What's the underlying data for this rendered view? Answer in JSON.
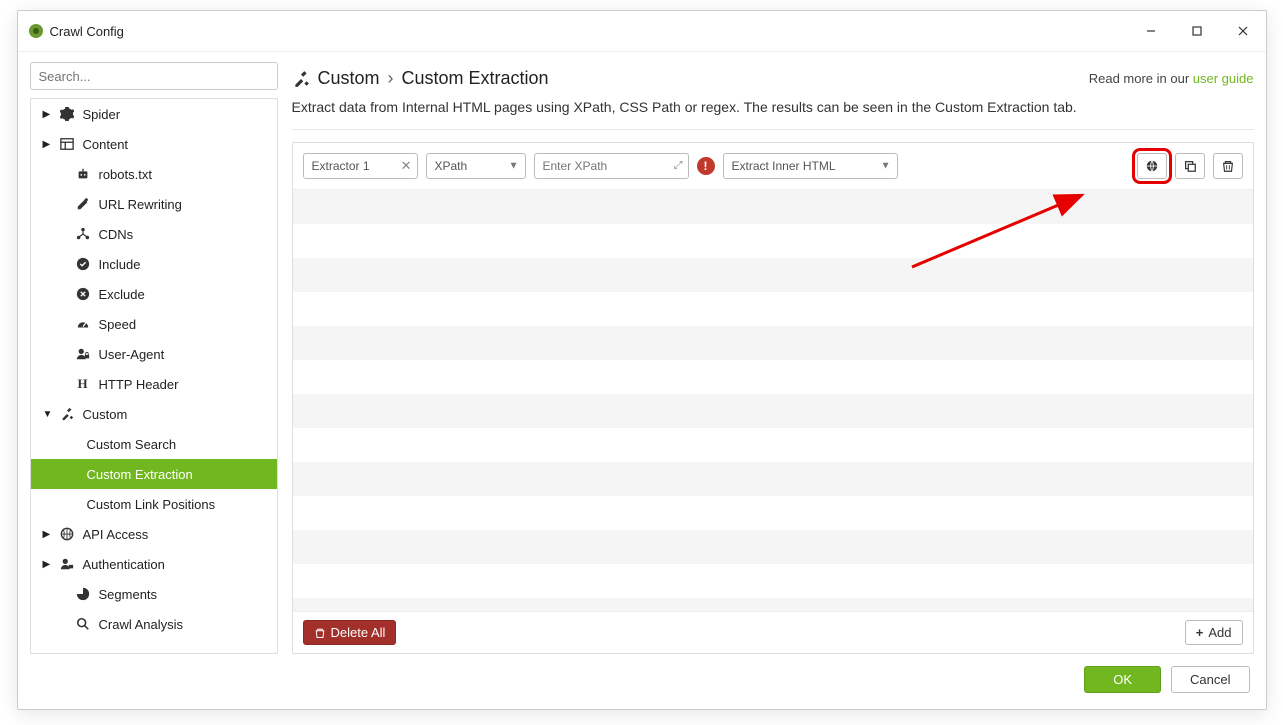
{
  "window": {
    "title": "Crawl Config"
  },
  "sidebar": {
    "search_placeholder": "Search...",
    "items": [
      {
        "label": "Spider"
      },
      {
        "label": "Content"
      },
      {
        "label": "robots.txt"
      },
      {
        "label": "URL Rewriting"
      },
      {
        "label": "CDNs"
      },
      {
        "label": "Include"
      },
      {
        "label": "Exclude"
      },
      {
        "label": "Speed"
      },
      {
        "label": "User-Agent"
      },
      {
        "label": "HTTP Header"
      },
      {
        "label": "Custom"
      },
      {
        "label": "Custom Search"
      },
      {
        "label": "Custom Extraction"
      },
      {
        "label": "Custom Link Positions"
      },
      {
        "label": "API Access"
      },
      {
        "label": "Authentication"
      },
      {
        "label": "Segments"
      },
      {
        "label": "Crawl Analysis"
      }
    ]
  },
  "header": {
    "crumb_parent": "Custom",
    "crumb_current": "Custom Extraction",
    "read_more_prefix": "Read more in our ",
    "read_more_link": "user guide"
  },
  "description": "Extract data from Internal HTML pages using XPath, CSS Path or regex. The results can be seen in the Custom Extraction tab.",
  "extractor": {
    "name_value": "Extractor 1",
    "method_value": "XPath",
    "xpath_placeholder": "Enter XPath",
    "extract_value": "Extract Inner HTML"
  },
  "actions": {
    "delete_all": "Delete All",
    "add": "Add",
    "ok": "OK",
    "cancel": "Cancel"
  }
}
